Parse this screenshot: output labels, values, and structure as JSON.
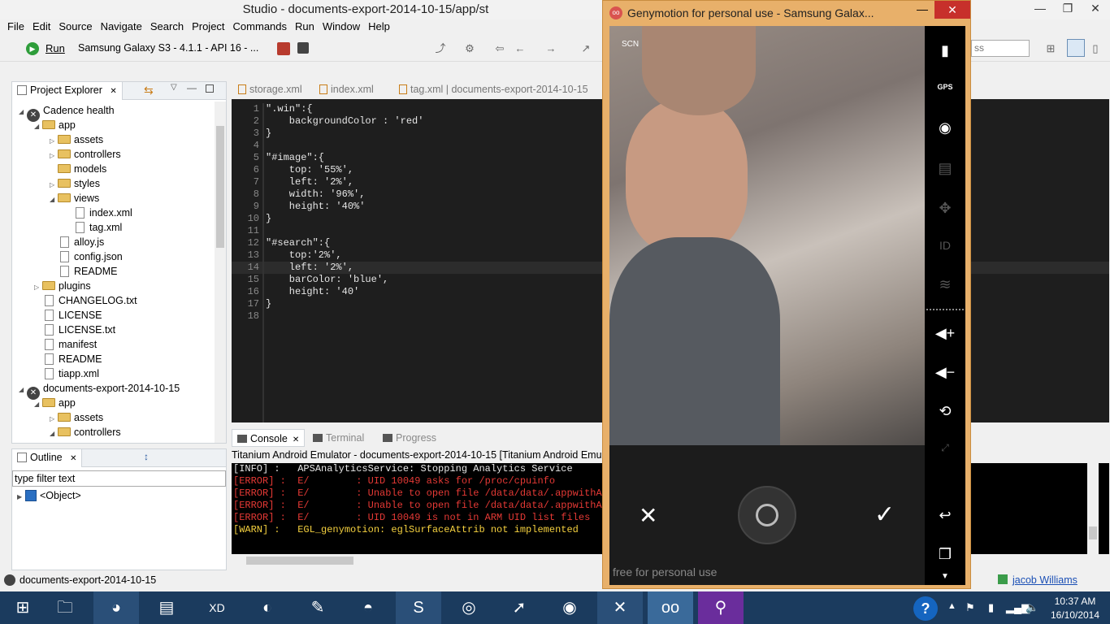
{
  "window": {
    "title": "Studio - documents-export-2014-10-15/app/st"
  },
  "menu": [
    "File",
    "Edit",
    "Source",
    "Navigate",
    "Search",
    "Project",
    "Commands",
    "Run",
    "Window",
    "Help"
  ],
  "toolbar": {
    "run_label": "Run",
    "device": "Samsung Galaxy S3 - 4.1.1 - API 16 - ...",
    "search_placeholder": "ss"
  },
  "project_explorer": {
    "tab_label": "Project Explorer",
    "items": [
      {
        "label": "Cadence health",
        "kind": "project",
        "depth": 0,
        "twisty": "▲"
      },
      {
        "label": "app",
        "kind": "folder",
        "depth": 1,
        "twisty": "▲"
      },
      {
        "label": "assets",
        "kind": "folder",
        "depth": 2,
        "twisty": "▶"
      },
      {
        "label": "controllers",
        "kind": "folder",
        "depth": 2,
        "twisty": "▶"
      },
      {
        "label": "models",
        "kind": "folder",
        "depth": 2,
        "twisty": ""
      },
      {
        "label": "styles",
        "kind": "folder",
        "depth": 2,
        "twisty": "▶"
      },
      {
        "label": "views",
        "kind": "folder",
        "depth": 2,
        "twisty": "▲"
      },
      {
        "label": "index.xml",
        "kind": "file",
        "depth": 3,
        "twisty": ""
      },
      {
        "label": "tag.xml",
        "kind": "file",
        "depth": 3,
        "twisty": ""
      },
      {
        "label": "alloy.js",
        "kind": "file",
        "depth": 2,
        "twisty": ""
      },
      {
        "label": "config.json",
        "kind": "file",
        "depth": 2,
        "twisty": ""
      },
      {
        "label": "README",
        "kind": "file",
        "depth": 2,
        "twisty": ""
      },
      {
        "label": "plugins",
        "kind": "folder",
        "depth": 1,
        "twisty": "▶"
      },
      {
        "label": "CHANGELOG.txt",
        "kind": "file",
        "depth": 1,
        "twisty": ""
      },
      {
        "label": "LICENSE",
        "kind": "file",
        "depth": 1,
        "twisty": ""
      },
      {
        "label": "LICENSE.txt",
        "kind": "file",
        "depth": 1,
        "twisty": ""
      },
      {
        "label": "manifest",
        "kind": "file",
        "depth": 1,
        "twisty": ""
      },
      {
        "label": "README",
        "kind": "file",
        "depth": 1,
        "twisty": ""
      },
      {
        "label": "tiapp.xml",
        "kind": "file",
        "depth": 1,
        "twisty": ""
      },
      {
        "label": "documents-export-2014-10-15",
        "kind": "project",
        "depth": 0,
        "twisty": "▲"
      },
      {
        "label": "app",
        "kind": "folder",
        "depth": 1,
        "twisty": "▲"
      },
      {
        "label": "assets",
        "kind": "folder",
        "depth": 2,
        "twisty": "▶"
      },
      {
        "label": "controllers",
        "kind": "folder",
        "depth": 2,
        "twisty": "▲"
      }
    ]
  },
  "outline": {
    "tab_label": "Outline",
    "filter_placeholder": "type filter text",
    "item": "<Object>"
  },
  "editor": {
    "tabs": [
      "storage.xml",
      "index.xml",
      "tag.xml | documents-export-2014-10-15"
    ],
    "lines": [
      "\".win\":{",
      "    backgroundColor : 'red'",
      "}",
      "",
      "\"#image\":{",
      "    top: '55%',",
      "    left: '2%',",
      "    width: '96%',",
      "    height: '40%'",
      "}",
      "",
      "\"#search\":{",
      "    top:'2%',",
      "    left: '2%',",
      "    barColor: 'blue',",
      "    height: '40'",
      "}",
      ""
    ]
  },
  "console": {
    "tabs": [
      "Console",
      "Terminal",
      "Progress"
    ],
    "header": "Titanium Android Emulator - documents-export-2014-10-15 [Titanium Android Emulat",
    "lines": [
      {
        "text": "[INFO] :   APSAnalyticsService: Stopping Analytics Service",
        "color": "#e6e6e6"
      },
      {
        "text": "[ERROR] :  E/        : UID 10049 asks for /proc/cpuinfo",
        "color": "#e53935"
      },
      {
        "text": "[ERROR] :  E/        : Unable to open file /data/data/.appwithABI",
        "color": "#e53935"
      },
      {
        "text": "[ERROR] :  E/        : Unable to open file /data/data/.appwithABI",
        "color": "#e53935"
      },
      {
        "text": "[ERROR] :  E/        : UID 10049 is not in ARM UID list files",
        "color": "#e53935"
      },
      {
        "text": "[WARN] :   EGL_genymotion: eglSurfaceAttrib not implemented",
        "color": "#f4d03f"
      }
    ]
  },
  "status": {
    "project": "documents-export-2014-10-15",
    "user": "jacob Williams"
  },
  "genymotion": {
    "title": "Genymotion for personal use - Samsung Galax...",
    "watermark": "free for personal use",
    "scn_label": "SCN"
  },
  "clock": {
    "time": "10:37 AM",
    "date": "16/10/2014"
  }
}
